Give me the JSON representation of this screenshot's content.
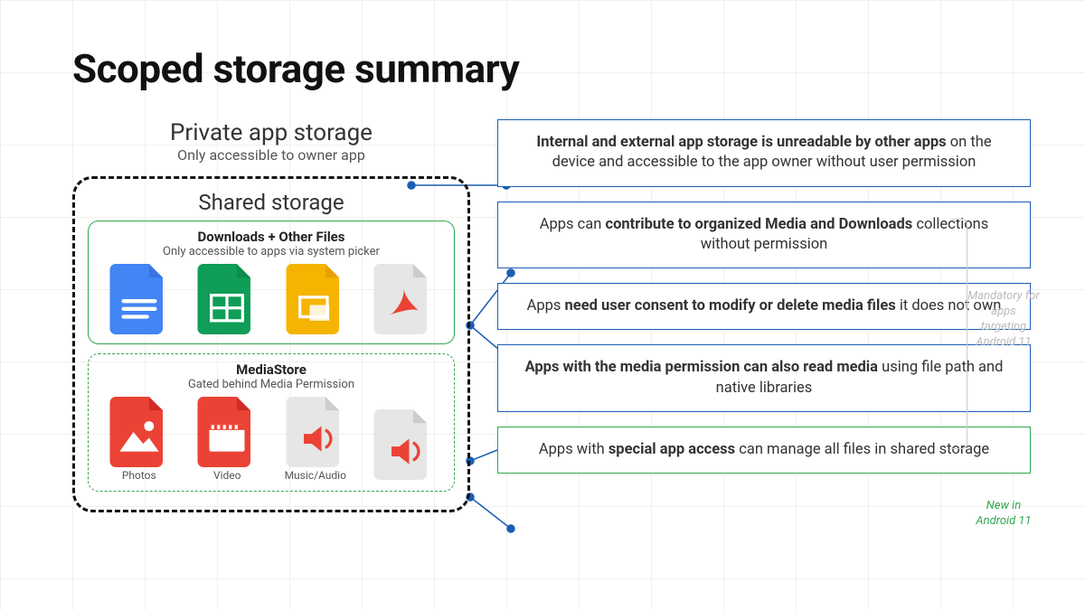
{
  "title": "Scoped storage summary",
  "private": {
    "heading": "Private app storage",
    "sub": "Only accessible to owner app"
  },
  "shared": {
    "heading": "Shared storage",
    "downloads": {
      "heading": "Downloads + Other Files",
      "sub": "Only accessible to apps via system picker",
      "icons": [
        "doc-file-icon",
        "sheet-file-icon",
        "slides-file-icon",
        "pdf-file-icon"
      ]
    },
    "mediastore": {
      "heading": "MediaStore",
      "sub": "Gated behind Media Permission",
      "items": [
        {
          "icon": "photo-file-icon",
          "label": "Photos"
        },
        {
          "icon": "video-file-icon",
          "label": "Video"
        },
        {
          "icon": "audio-file-icon",
          "label": "Music/Audio"
        },
        {
          "icon": "audio-file-icon",
          "label": ""
        }
      ]
    }
  },
  "callouts": [
    {
      "pre": "",
      "bold": "Internal and external app storage is unreadable by other apps",
      "post": " on the device and accessible to the app owner without user permission",
      "color": "blue"
    },
    {
      "pre": "Apps can ",
      "bold": "contribute to organized Media and Downloads",
      "post": " collections without permission",
      "color": "blue"
    },
    {
      "pre": "Apps ",
      "bold": "need user consent to modify or delete media files",
      "post": " it does not own",
      "color": "blue"
    },
    {
      "pre": "",
      "bold": "Apps with the media permission can also read media",
      "post": " using file path and native libraries",
      "color": "blue"
    },
    {
      "pre": "Apps with ",
      "bold": "special app access",
      "post": " can manage all files in shared storage",
      "color": "green"
    }
  ],
  "notes": {
    "mandatory": "Mandatory for apps targeting Android 11",
    "new": "New in Android 11"
  },
  "colors": {
    "blue": "#1a5db4",
    "green": "#2fa84f",
    "docBlue": "#4285f4",
    "sheetGreen": "#0f9d58",
    "slidesYellow": "#f4b400",
    "grey": "#e6e6e6",
    "red": "#ea4335"
  }
}
